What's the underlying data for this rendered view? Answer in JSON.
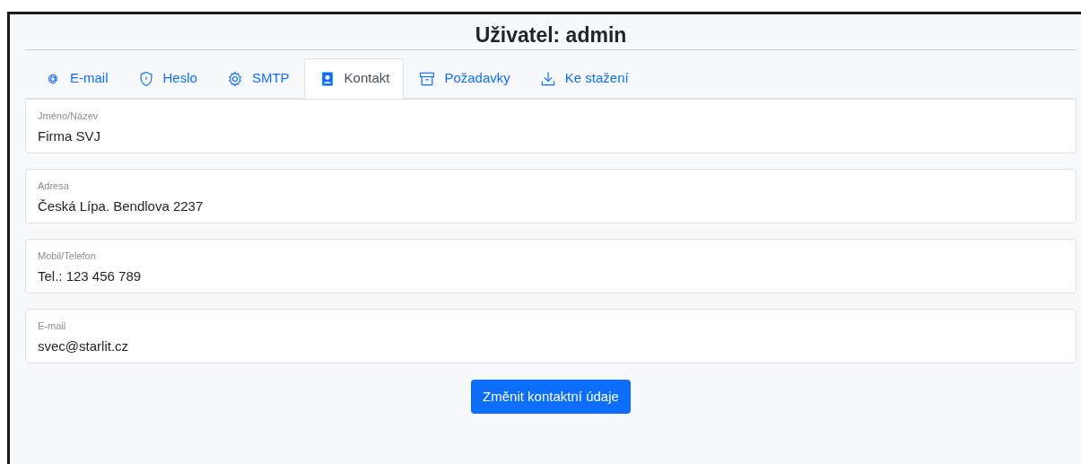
{
  "title": "Uživatel: admin",
  "tabs": [
    {
      "kind": "at",
      "label": "E-mail",
      "selected": false
    },
    {
      "kind": "shield",
      "label": "Heslo",
      "selected": false
    },
    {
      "kind": "gear",
      "label": "SMTP",
      "selected": false
    },
    {
      "kind": "contact",
      "label": "Kontakt",
      "selected": true
    },
    {
      "kind": "archive",
      "label": "Požadavky",
      "selected": false
    },
    {
      "kind": "download",
      "label": "Ke stažení",
      "selected": false
    }
  ],
  "fields": [
    {
      "label": "Jméno/Název",
      "value": "Firma SVJ"
    },
    {
      "label": "Adresa",
      "value": "Česká Lípa. Bendlova 2237"
    },
    {
      "label": "Mobil/Telefon",
      "value": "Tel.: 123 456 789"
    },
    {
      "label": "E-mail",
      "value": "svec@starlit.cz"
    }
  ],
  "button": "Změnit kontaktní údaje"
}
